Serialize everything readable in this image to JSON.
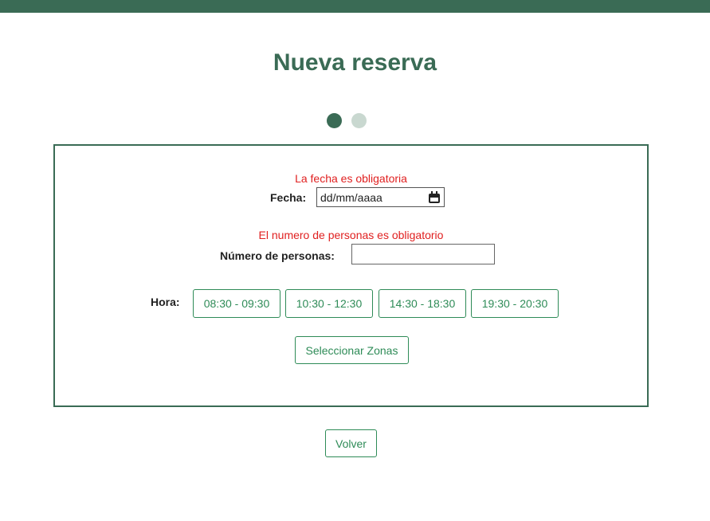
{
  "header": {
    "title": "Nueva reserva",
    "accent_color": "#3a6b55"
  },
  "steps": {
    "current": 1,
    "total": 2
  },
  "form": {
    "date": {
      "error": "La fecha es obligatoria",
      "label": "Fecha:",
      "placeholder": "dd/mm/aaaa",
      "icon": "calendar-icon"
    },
    "persons": {
      "error": "El numero de personas es obligatorio",
      "label": "Número de personas:",
      "value": ""
    },
    "time": {
      "label": "Hora:",
      "slots": [
        "08:30 - 09:30",
        "10:30 - 12:30",
        "14:30 - 18:30",
        "19:30 - 20:30"
      ]
    },
    "select_zones_label": "Seleccionar Zonas",
    "error_color": "#e02020",
    "button_color": "#2e8b57"
  },
  "footer": {
    "back_label": "Volver"
  }
}
